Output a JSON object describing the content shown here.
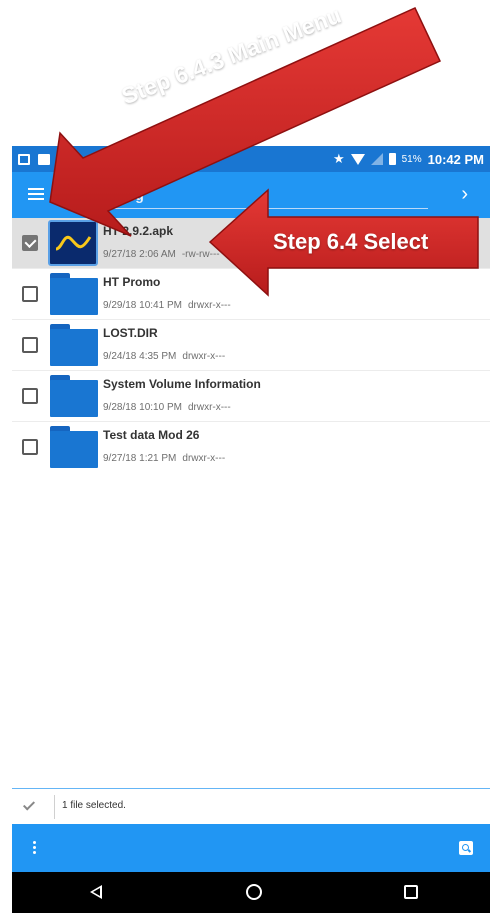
{
  "status_bar": {
    "battery_percent": "51%",
    "time": "10:42 PM"
  },
  "toolbar": {
    "path_label": "otg",
    "menu_icon": "hamburger-menu-icon",
    "forward_icon": "chevron-right-icon"
  },
  "files": [
    {
      "name": "HT 2.9.2.apk",
      "date": "9/27/18 2:06 AM",
      "perms": "-rw-rw---",
      "type": "apk",
      "selected": true
    },
    {
      "name": "HT Promo",
      "date": "9/29/18 10:41 PM",
      "perms": "drwxr-x---",
      "type": "folder",
      "selected": false
    },
    {
      "name": "LOST.DIR",
      "date": "9/24/18 4:35 PM",
      "perms": "drwxr-x---",
      "type": "folder",
      "selected": false
    },
    {
      "name": "System Volume Information",
      "date": "9/28/18 10:10 PM",
      "perms": "drwxr-x---",
      "type": "folder",
      "selected": false
    },
    {
      "name": "Test data Mod 26",
      "date": "9/27/18 1:21 PM",
      "perms": "drwxr-x---",
      "type": "folder",
      "selected": false
    }
  ],
  "selection": {
    "status_text": "1 file selected."
  },
  "annotations": {
    "main_menu": "Step 6.4.3 Main Menu",
    "select": "Step 6.4 Select",
    "arrow_color": "#c62828"
  },
  "colors": {
    "status_bar": "#1976d2",
    "toolbar": "#2196f3",
    "folder": "#1976d2"
  }
}
